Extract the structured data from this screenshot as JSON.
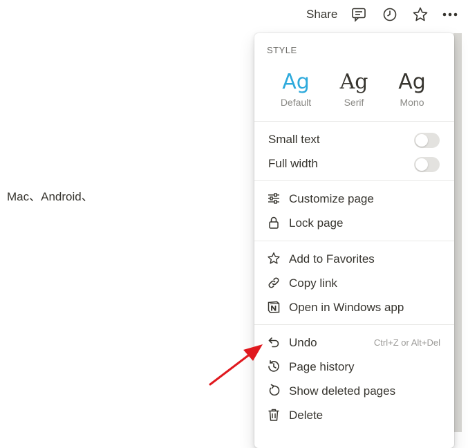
{
  "topbar": {
    "share_label": "Share",
    "icons": [
      "comment-icon",
      "history-clock-icon",
      "favorite-star-icon",
      "more-dots-icon"
    ]
  },
  "page": {
    "body_text": "Mac、Android、"
  },
  "menu": {
    "style_label": "STYLE",
    "fonts": [
      {
        "glyph": "Ag",
        "label": "Default",
        "selected": true
      },
      {
        "glyph": "Ag",
        "label": "Serif",
        "selected": false
      },
      {
        "glyph": "Ag",
        "label": "Mono",
        "selected": false
      }
    ],
    "toggles": [
      {
        "label": "Small text",
        "on": false
      },
      {
        "label": "Full width",
        "on": false
      }
    ],
    "page_items": [
      {
        "label": "Customize page",
        "icon": "sliders-icon"
      },
      {
        "label": "Lock page",
        "icon": "lock-icon"
      }
    ],
    "share_items": [
      {
        "label": "Add to Favorites",
        "icon": "star-outline-icon"
      },
      {
        "label": "Copy link",
        "icon": "link-icon"
      },
      {
        "label": "Open in Windows app",
        "icon": "notion-logo-icon"
      }
    ],
    "history_items": [
      {
        "label": "Undo",
        "icon": "undo-arrow-icon",
        "shortcut": "Ctrl+Z or Alt+Del"
      },
      {
        "label": "Page history",
        "icon": "history-clock-icon"
      },
      {
        "label": "Show deleted pages",
        "icon": "restore-icon"
      },
      {
        "label": "Delete",
        "icon": "trash-icon"
      }
    ]
  },
  "colors": {
    "accent": "#2eaadc",
    "text": "#37352f",
    "muted": "#8a8985",
    "annotation": "#e0191f"
  }
}
